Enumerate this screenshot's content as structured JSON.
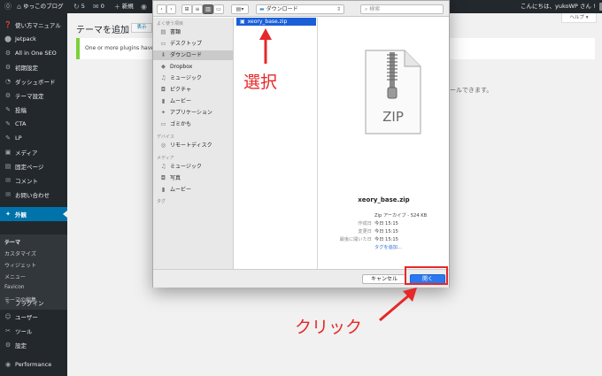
{
  "adminbar": {
    "site_name": "ゆっこのブログ",
    "updates": "5",
    "comments": "0",
    "new_label": "新規",
    "greeting": "こんにちは、yukoWP さん !"
  },
  "help_label": "ヘルプ ▾",
  "sidebar": {
    "items": [
      {
        "label": "使い方マニュアル",
        "icon": "manual-icon",
        "glyph": "❓"
      },
      {
        "label": "Jetpack",
        "icon": "jetpack-icon",
        "glyph": "⬤"
      },
      {
        "label": "All in One SEO",
        "icon": "seo-icon",
        "glyph": "⚙"
      },
      {
        "label": "初期設定",
        "icon": "setup-icon",
        "glyph": "⚙"
      },
      {
        "label": "ダッシュボード",
        "icon": "dashboard-icon",
        "glyph": "◔"
      },
      {
        "label": "テーマ設定",
        "icon": "theme-settings-icon",
        "glyph": "⚙"
      },
      {
        "label": "投稿",
        "icon": "pin-icon",
        "glyph": "✎"
      },
      {
        "label": "CTA",
        "icon": "pin-icon",
        "glyph": "✎"
      },
      {
        "label": "LP",
        "icon": "pin-icon",
        "glyph": "✎"
      },
      {
        "label": "メディア",
        "icon": "media-icon",
        "glyph": "▣"
      },
      {
        "label": "固定ページ",
        "icon": "page-icon",
        "glyph": "▤"
      },
      {
        "label": "コメント",
        "icon": "comment-icon",
        "glyph": "✉"
      },
      {
        "label": "お問い合わせ",
        "icon": "mail-icon",
        "glyph": "✉"
      },
      {
        "label": "外観",
        "icon": "appearance-icon",
        "glyph": "✦"
      }
    ],
    "submenu": [
      "テーマ",
      "カスタマイズ",
      "ウィジェット",
      "メニュー",
      "Favicon",
      "テーマの編集"
    ],
    "lower_items": [
      {
        "label": "プラグイン",
        "icon": "plugin-icon",
        "glyph": "⚡"
      },
      {
        "label": "ユーザー",
        "icon": "user-icon",
        "glyph": "☺"
      },
      {
        "label": "ツール",
        "icon": "tool-icon",
        "glyph": "✂"
      },
      {
        "label": "設定",
        "icon": "settings-icon",
        "glyph": "⚙"
      },
      {
        "label": "Performance",
        "icon": "performance-icon",
        "glyph": "◉"
      }
    ]
  },
  "main": {
    "title": "テーマを追加",
    "upload_button": "表示",
    "notice": "One or more plugins have been",
    "text_right": "ールできます。"
  },
  "dialog": {
    "location": "ダウンロード",
    "search_placeholder": "検索",
    "sections": [
      {
        "title": "よく使う項目",
        "items": [
          {
            "label": "書類",
            "icon": "documents-icon",
            "glyph": "▤"
          },
          {
            "label": "デスクトップ",
            "icon": "desktop-icon",
            "glyph": "▭"
          },
          {
            "label": "ダウンロード",
            "icon": "downloads-icon",
            "glyph": "⬇",
            "selected": true
          },
          {
            "label": "Dropbox",
            "icon": "dropbox-icon",
            "glyph": "◆"
          },
          {
            "label": "ミュージック",
            "icon": "music-icon",
            "glyph": "♫"
          },
          {
            "label": "ピクチャ",
            "icon": "pictures-icon",
            "glyph": "◘"
          },
          {
            "label": "ムービー",
            "icon": "movies-icon",
            "glyph": "▮"
          },
          {
            "label": "アプリケーション",
            "icon": "applications-icon",
            "glyph": "✦"
          },
          {
            "label": "ゴミかも",
            "icon": "folder-icon",
            "glyph": "▭"
          }
        ]
      },
      {
        "title": "デバイス",
        "items": [
          {
            "label": "リモートディスク",
            "icon": "disc-icon",
            "glyph": "◎"
          }
        ]
      },
      {
        "title": "メディア",
        "items": [
          {
            "label": "ミュージック",
            "icon": "music-icon",
            "glyph": "♫"
          },
          {
            "label": "写真",
            "icon": "photos-icon",
            "glyph": "◘"
          },
          {
            "label": "ムービー",
            "icon": "movies-icon",
            "glyph": "▮"
          }
        ]
      },
      {
        "title": "タグ",
        "items": []
      }
    ],
    "file_name": "xeory_base.zip",
    "preview": {
      "icon_text": "ZIP",
      "name": "xeory_base.zip",
      "info": [
        {
          "key": "",
          "value": "Zip アーカイブ - 524 KB"
        },
        {
          "key": "作成日",
          "value": "今日 15:15"
        },
        {
          "key": "変更日",
          "value": "今日 15:15"
        },
        {
          "key": "最後に開いた日",
          "value": "今日 15:15"
        },
        {
          "key": "",
          "value": "タグを追加...",
          "link": true
        }
      ]
    },
    "cancel_label": "キャンセル",
    "open_label": "開く"
  },
  "annotations": {
    "select": "選択",
    "click": "クリック",
    "color": "#e62828"
  },
  "colors": {
    "admin_dark": "#23282d",
    "wp_blue": "#0073aa",
    "mac_selection": "#1a5fd8",
    "open_button": "#2a79f0"
  }
}
